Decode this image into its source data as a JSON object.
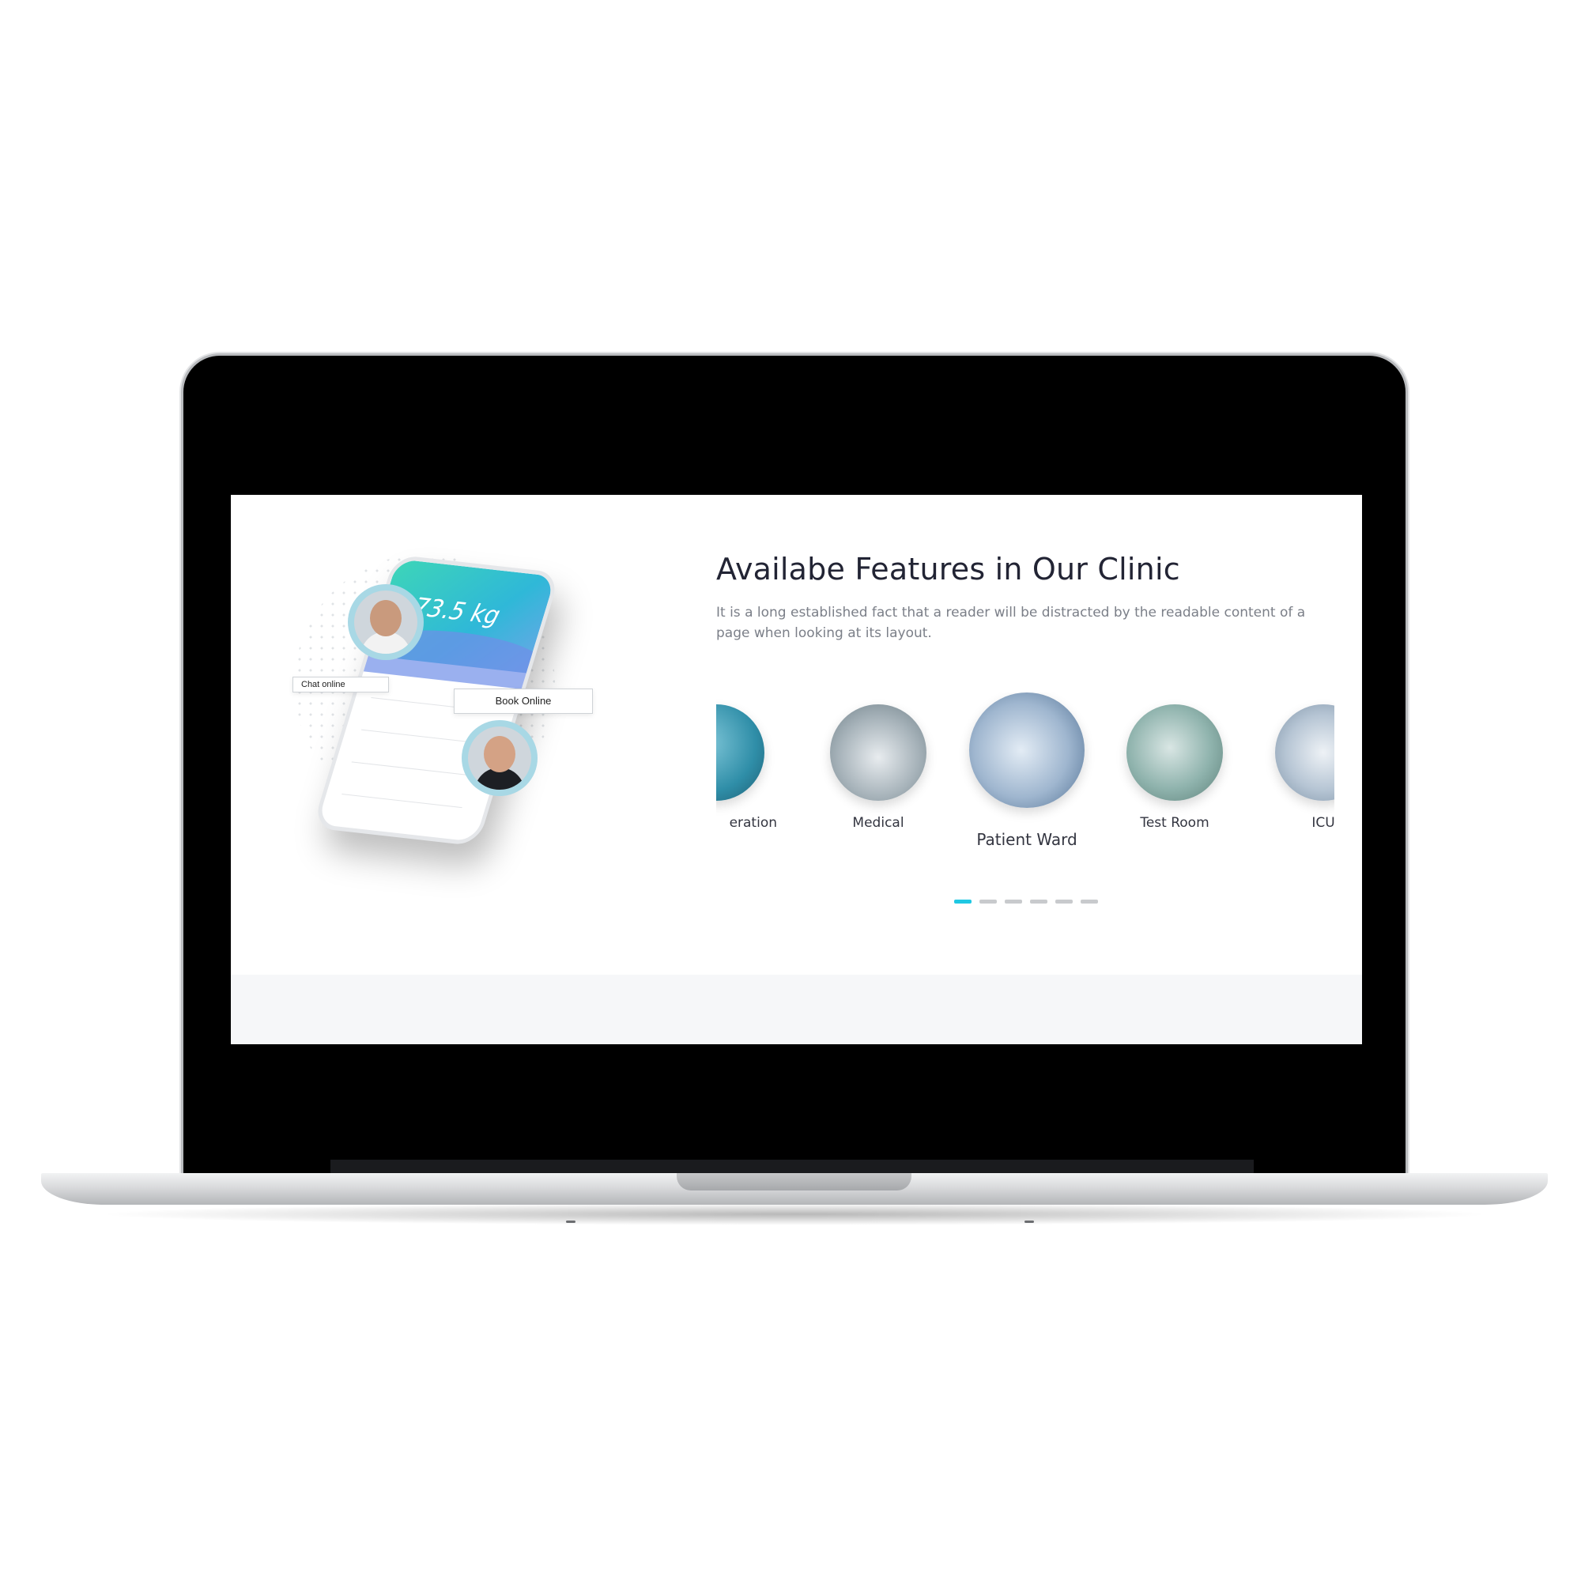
{
  "device": "laptop",
  "colors": {
    "accent": "#1fc8e3",
    "heading": "#222434",
    "body_text": "#7b7f88",
    "footer_band": "#f6f7f9"
  },
  "hero_image": {
    "weight_reading": "73.5 kg",
    "chat_tag": "Chat online",
    "book_tag": "Book Online"
  },
  "section": {
    "title": "Availabe Features in Our Clinic",
    "description": "It is a long established fact that a reader will be distracted by the readable content of a page when looking at its layout."
  },
  "features": [
    {
      "label": "eration",
      "icon": "operation-photo"
    },
    {
      "label": "Medical",
      "icon": "pharmacy-photo"
    },
    {
      "label": "Patient Ward",
      "icon": "ward-photo"
    },
    {
      "label": "Test Room",
      "icon": "test-room-photo"
    },
    {
      "label": "ICU",
      "icon": "icu-photo"
    }
  ],
  "carousel": {
    "page_count": 6,
    "active_page": 1
  }
}
